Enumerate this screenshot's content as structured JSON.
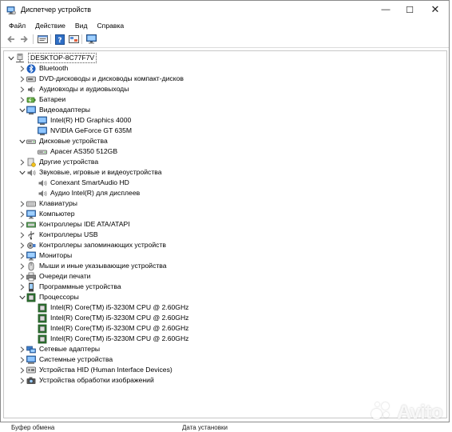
{
  "window": {
    "title": "Диспетчер устройств",
    "controls": {
      "minimize": "—",
      "maximize": "☐",
      "close": "✕"
    }
  },
  "menu": [
    "Файл",
    "Действие",
    "Вид",
    "Справка"
  ],
  "toolbar": [
    "back-icon",
    "forward-icon",
    "properties-icon",
    "help-icon",
    "device-view-icon",
    "monitor-icon"
  ],
  "tree": [
    {
      "label": "DESKTOP-8C77F7V",
      "level": 0,
      "expander": "open",
      "icon": "computer-icon",
      "name": "tree-root"
    },
    {
      "label": "Bluetooth",
      "level": 1,
      "expander": "closed",
      "icon": "bluetooth-icon",
      "name": "category-bluetooth"
    },
    {
      "label": "DVD-дисководы и дисководы компакт-дисков",
      "level": 1,
      "expander": "closed",
      "icon": "dvd-drive-icon",
      "name": "category-dvd"
    },
    {
      "label": "Аудиовходы и аудиовыходы",
      "level": 1,
      "expander": "closed",
      "icon": "audio-io-icon",
      "name": "category-audio-io"
    },
    {
      "label": "Батареи",
      "level": 1,
      "expander": "closed",
      "icon": "battery-icon",
      "name": "category-batteries"
    },
    {
      "label": "Видеоадаптеры",
      "level": 1,
      "expander": "open",
      "icon": "display-adapter-icon",
      "name": "category-display-adapters"
    },
    {
      "label": "Intel(R) HD Graphics 4000",
      "level": 2,
      "expander": "none",
      "icon": "display-adapter-icon",
      "name": "device-intel-hd-graphics"
    },
    {
      "label": "NVIDIA GeForce GT 635M",
      "level": 2,
      "expander": "none",
      "icon": "display-adapter-icon",
      "name": "device-nvidia-geforce"
    },
    {
      "label": "Дисковые устройства",
      "level": 1,
      "expander": "open",
      "icon": "disk-drive-icon",
      "name": "category-disk-drives"
    },
    {
      "label": "Apacer AS350 512GB",
      "level": 2,
      "expander": "none",
      "icon": "disk-drive-icon",
      "name": "device-apacer-ssd"
    },
    {
      "label": "Другие устройства",
      "level": 1,
      "expander": "closed",
      "icon": "other-devices-icon",
      "name": "category-other-devices"
    },
    {
      "label": "Звуковые, игровые и видеоустройства",
      "level": 1,
      "expander": "open",
      "icon": "speaker-icon",
      "name": "category-sound-devices"
    },
    {
      "label": "Conexant SmartAudio HD",
      "level": 2,
      "expander": "none",
      "icon": "speaker-icon",
      "name": "device-conexant-audio"
    },
    {
      "label": "Аудио Intel(R) для дисплеев",
      "level": 2,
      "expander": "none",
      "icon": "speaker-icon",
      "name": "device-intel-display-audio"
    },
    {
      "label": "Клавиатуры",
      "level": 1,
      "expander": "closed",
      "icon": "keyboard-icon",
      "name": "category-keyboards"
    },
    {
      "label": "Компьютер",
      "level": 1,
      "expander": "closed",
      "icon": "monitor-icon",
      "name": "category-computer"
    },
    {
      "label": "Контроллеры IDE ATA/ATAPI",
      "level": 1,
      "expander": "closed",
      "icon": "ide-controller-icon",
      "name": "category-ide-controllers"
    },
    {
      "label": "Контроллеры USB",
      "level": 1,
      "expander": "closed",
      "icon": "usb-icon",
      "name": "category-usb-controllers"
    },
    {
      "label": "Контроллеры запоминающих устройств",
      "level": 1,
      "expander": "closed",
      "icon": "storage-controller-icon",
      "name": "category-storage-controllers"
    },
    {
      "label": "Мониторы",
      "level": 1,
      "expander": "closed",
      "icon": "monitor-icon",
      "name": "category-monitors"
    },
    {
      "label": "Мыши и иные указывающие устройства",
      "level": 1,
      "expander": "closed",
      "icon": "mouse-icon",
      "name": "category-mice"
    },
    {
      "label": "Очереди печати",
      "level": 1,
      "expander": "closed",
      "icon": "printer-icon",
      "name": "category-print-queues"
    },
    {
      "label": "Программные устройства",
      "level": 1,
      "expander": "closed",
      "icon": "software-device-icon",
      "name": "category-software-devices"
    },
    {
      "label": "Процессоры",
      "level": 1,
      "expander": "open",
      "icon": "processor-icon",
      "name": "category-processors"
    },
    {
      "label": "Intel(R) Core(TM) i5-3230M CPU @ 2.60GHz",
      "level": 2,
      "expander": "none",
      "icon": "processor-icon",
      "name": "device-cpu-core-1"
    },
    {
      "label": "Intel(R) Core(TM) i5-3230M CPU @ 2.60GHz",
      "level": 2,
      "expander": "none",
      "icon": "processor-icon",
      "name": "device-cpu-core-2"
    },
    {
      "label": "Intel(R) Core(TM) i5-3230M CPU @ 2.60GHz",
      "level": 2,
      "expander": "none",
      "icon": "processor-icon",
      "name": "device-cpu-core-3"
    },
    {
      "label": "Intel(R) Core(TM) i5-3230M CPU @ 2.60GHz",
      "level": 2,
      "expander": "none",
      "icon": "processor-icon",
      "name": "device-cpu-core-4"
    },
    {
      "label": "Сетевые адаптеры",
      "level": 1,
      "expander": "closed",
      "icon": "network-adapter-icon",
      "name": "category-network-adapters"
    },
    {
      "label": "Системные устройства",
      "level": 1,
      "expander": "closed",
      "icon": "system-device-icon",
      "name": "category-system-devices"
    },
    {
      "label": "Устройства HID (Human Interface Devices)",
      "level": 1,
      "expander": "closed",
      "icon": "hid-icon",
      "name": "category-hid"
    },
    {
      "label": "Устройства обработки изображений",
      "level": 1,
      "expander": "closed",
      "icon": "camera-icon",
      "name": "category-imaging-devices"
    }
  ],
  "statusbar": {
    "left": "Буфер обмена",
    "right": "Дата установки"
  },
  "watermark": "Avito"
}
